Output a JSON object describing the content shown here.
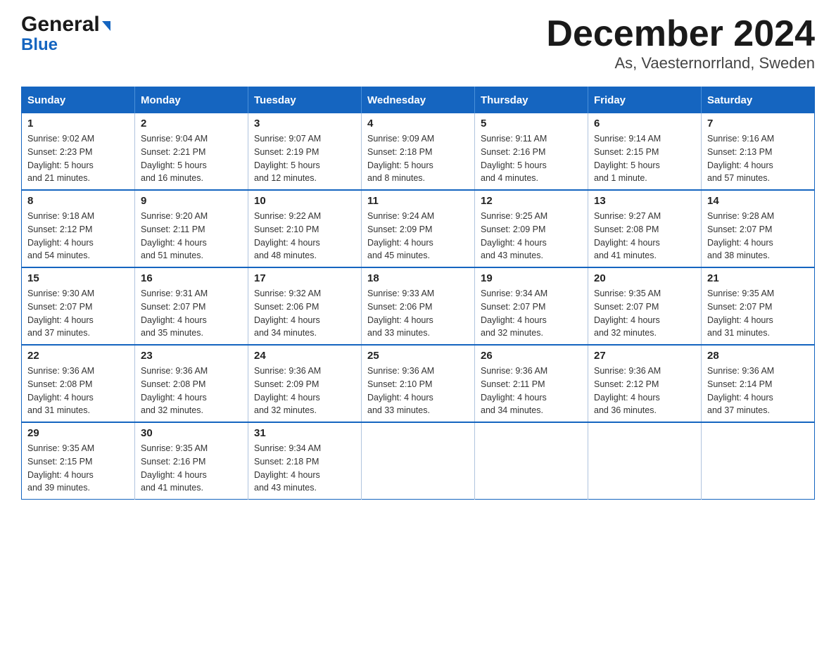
{
  "logo": {
    "general": "General",
    "blue": "Blue",
    "arrow": "▶"
  },
  "title": "December 2024",
  "subtitle": "As, Vaesternorrland, Sweden",
  "days_of_week": [
    "Sunday",
    "Monday",
    "Tuesday",
    "Wednesday",
    "Thursday",
    "Friday",
    "Saturday"
  ],
  "weeks": [
    [
      {
        "day": "1",
        "sunrise": "Sunrise: 9:02 AM",
        "sunset": "Sunset: 2:23 PM",
        "daylight": "Daylight: 5 hours",
        "daylight2": "and 21 minutes."
      },
      {
        "day": "2",
        "sunrise": "Sunrise: 9:04 AM",
        "sunset": "Sunset: 2:21 PM",
        "daylight": "Daylight: 5 hours",
        "daylight2": "and 16 minutes."
      },
      {
        "day": "3",
        "sunrise": "Sunrise: 9:07 AM",
        "sunset": "Sunset: 2:19 PM",
        "daylight": "Daylight: 5 hours",
        "daylight2": "and 12 minutes."
      },
      {
        "day": "4",
        "sunrise": "Sunrise: 9:09 AM",
        "sunset": "Sunset: 2:18 PM",
        "daylight": "Daylight: 5 hours",
        "daylight2": "and 8 minutes."
      },
      {
        "day": "5",
        "sunrise": "Sunrise: 9:11 AM",
        "sunset": "Sunset: 2:16 PM",
        "daylight": "Daylight: 5 hours",
        "daylight2": "and 4 minutes."
      },
      {
        "day": "6",
        "sunrise": "Sunrise: 9:14 AM",
        "sunset": "Sunset: 2:15 PM",
        "daylight": "Daylight: 5 hours",
        "daylight2": "and 1 minute."
      },
      {
        "day": "7",
        "sunrise": "Sunrise: 9:16 AM",
        "sunset": "Sunset: 2:13 PM",
        "daylight": "Daylight: 4 hours",
        "daylight2": "and 57 minutes."
      }
    ],
    [
      {
        "day": "8",
        "sunrise": "Sunrise: 9:18 AM",
        "sunset": "Sunset: 2:12 PM",
        "daylight": "Daylight: 4 hours",
        "daylight2": "and 54 minutes."
      },
      {
        "day": "9",
        "sunrise": "Sunrise: 9:20 AM",
        "sunset": "Sunset: 2:11 PM",
        "daylight": "Daylight: 4 hours",
        "daylight2": "and 51 minutes."
      },
      {
        "day": "10",
        "sunrise": "Sunrise: 9:22 AM",
        "sunset": "Sunset: 2:10 PM",
        "daylight": "Daylight: 4 hours",
        "daylight2": "and 48 minutes."
      },
      {
        "day": "11",
        "sunrise": "Sunrise: 9:24 AM",
        "sunset": "Sunset: 2:09 PM",
        "daylight": "Daylight: 4 hours",
        "daylight2": "and 45 minutes."
      },
      {
        "day": "12",
        "sunrise": "Sunrise: 9:25 AM",
        "sunset": "Sunset: 2:09 PM",
        "daylight": "Daylight: 4 hours",
        "daylight2": "and 43 minutes."
      },
      {
        "day": "13",
        "sunrise": "Sunrise: 9:27 AM",
        "sunset": "Sunset: 2:08 PM",
        "daylight": "Daylight: 4 hours",
        "daylight2": "and 41 minutes."
      },
      {
        "day": "14",
        "sunrise": "Sunrise: 9:28 AM",
        "sunset": "Sunset: 2:07 PM",
        "daylight": "Daylight: 4 hours",
        "daylight2": "and 38 minutes."
      }
    ],
    [
      {
        "day": "15",
        "sunrise": "Sunrise: 9:30 AM",
        "sunset": "Sunset: 2:07 PM",
        "daylight": "Daylight: 4 hours",
        "daylight2": "and 37 minutes."
      },
      {
        "day": "16",
        "sunrise": "Sunrise: 9:31 AM",
        "sunset": "Sunset: 2:07 PM",
        "daylight": "Daylight: 4 hours",
        "daylight2": "and 35 minutes."
      },
      {
        "day": "17",
        "sunrise": "Sunrise: 9:32 AM",
        "sunset": "Sunset: 2:06 PM",
        "daylight": "Daylight: 4 hours",
        "daylight2": "and 34 minutes."
      },
      {
        "day": "18",
        "sunrise": "Sunrise: 9:33 AM",
        "sunset": "Sunset: 2:06 PM",
        "daylight": "Daylight: 4 hours",
        "daylight2": "and 33 minutes."
      },
      {
        "day": "19",
        "sunrise": "Sunrise: 9:34 AM",
        "sunset": "Sunset: 2:07 PM",
        "daylight": "Daylight: 4 hours",
        "daylight2": "and 32 minutes."
      },
      {
        "day": "20",
        "sunrise": "Sunrise: 9:35 AM",
        "sunset": "Sunset: 2:07 PM",
        "daylight": "Daylight: 4 hours",
        "daylight2": "and 32 minutes."
      },
      {
        "day": "21",
        "sunrise": "Sunrise: 9:35 AM",
        "sunset": "Sunset: 2:07 PM",
        "daylight": "Daylight: 4 hours",
        "daylight2": "and 31 minutes."
      }
    ],
    [
      {
        "day": "22",
        "sunrise": "Sunrise: 9:36 AM",
        "sunset": "Sunset: 2:08 PM",
        "daylight": "Daylight: 4 hours",
        "daylight2": "and 31 minutes."
      },
      {
        "day": "23",
        "sunrise": "Sunrise: 9:36 AM",
        "sunset": "Sunset: 2:08 PM",
        "daylight": "Daylight: 4 hours",
        "daylight2": "and 32 minutes."
      },
      {
        "day": "24",
        "sunrise": "Sunrise: 9:36 AM",
        "sunset": "Sunset: 2:09 PM",
        "daylight": "Daylight: 4 hours",
        "daylight2": "and 32 minutes."
      },
      {
        "day": "25",
        "sunrise": "Sunrise: 9:36 AM",
        "sunset": "Sunset: 2:10 PM",
        "daylight": "Daylight: 4 hours",
        "daylight2": "and 33 minutes."
      },
      {
        "day": "26",
        "sunrise": "Sunrise: 9:36 AM",
        "sunset": "Sunset: 2:11 PM",
        "daylight": "Daylight: 4 hours",
        "daylight2": "and 34 minutes."
      },
      {
        "day": "27",
        "sunrise": "Sunrise: 9:36 AM",
        "sunset": "Sunset: 2:12 PM",
        "daylight": "Daylight: 4 hours",
        "daylight2": "and 36 minutes."
      },
      {
        "day": "28",
        "sunrise": "Sunrise: 9:36 AM",
        "sunset": "Sunset: 2:14 PM",
        "daylight": "Daylight: 4 hours",
        "daylight2": "and 37 minutes."
      }
    ],
    [
      {
        "day": "29",
        "sunrise": "Sunrise: 9:35 AM",
        "sunset": "Sunset: 2:15 PM",
        "daylight": "Daylight: 4 hours",
        "daylight2": "and 39 minutes."
      },
      {
        "day": "30",
        "sunrise": "Sunrise: 9:35 AM",
        "sunset": "Sunset: 2:16 PM",
        "daylight": "Daylight: 4 hours",
        "daylight2": "and 41 minutes."
      },
      {
        "day": "31",
        "sunrise": "Sunrise: 9:34 AM",
        "sunset": "Sunset: 2:18 PM",
        "daylight": "Daylight: 4 hours",
        "daylight2": "and 43 minutes."
      },
      null,
      null,
      null,
      null
    ]
  ]
}
